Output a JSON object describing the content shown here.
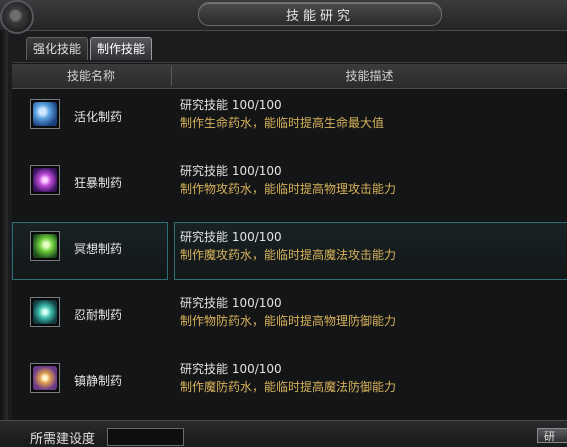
{
  "window": {
    "title": "技能研究"
  },
  "tabs": [
    {
      "label": "强化技能",
      "active": false
    },
    {
      "label": "制作技能",
      "active": true
    }
  ],
  "table": {
    "col_name": "技能名称",
    "col_desc": "技能描述",
    "rows": [
      {
        "icon": "life-potion-skill-icon",
        "name": "活化制药",
        "level": "研究技能 100/100",
        "effect": "制作生命药水，能临时提高生命最大值",
        "selected": false
      },
      {
        "icon": "berserk-potion-skill-icon",
        "name": "狂暴制药",
        "level": "研究技能 100/100",
        "effect": "制作物攻药水，能临时提高物理攻击能力",
        "selected": false
      },
      {
        "icon": "meditation-potion-skill-icon",
        "name": "冥想制药",
        "level": "研究技能 100/100",
        "effect": "制作魔攻药水，能临时提高魔法攻击能力",
        "selected": true
      },
      {
        "icon": "endurance-potion-skill-icon",
        "name": "忍耐制药",
        "level": "研究技能 100/100",
        "effect": "制作物防药水，能临时提高物理防御能力",
        "selected": false
      },
      {
        "icon": "calm-potion-skill-icon",
        "name": "镇静制药",
        "level": "研究技能 100/100",
        "effect": "制作魔防药水，能临时提高魔法防御能力",
        "selected": false
      }
    ]
  },
  "footer": {
    "label": "所需建设度",
    "button_partial": "研"
  },
  "colors": {
    "accent_gold": "#d8b35c",
    "selection_border": "#2e6e78"
  }
}
